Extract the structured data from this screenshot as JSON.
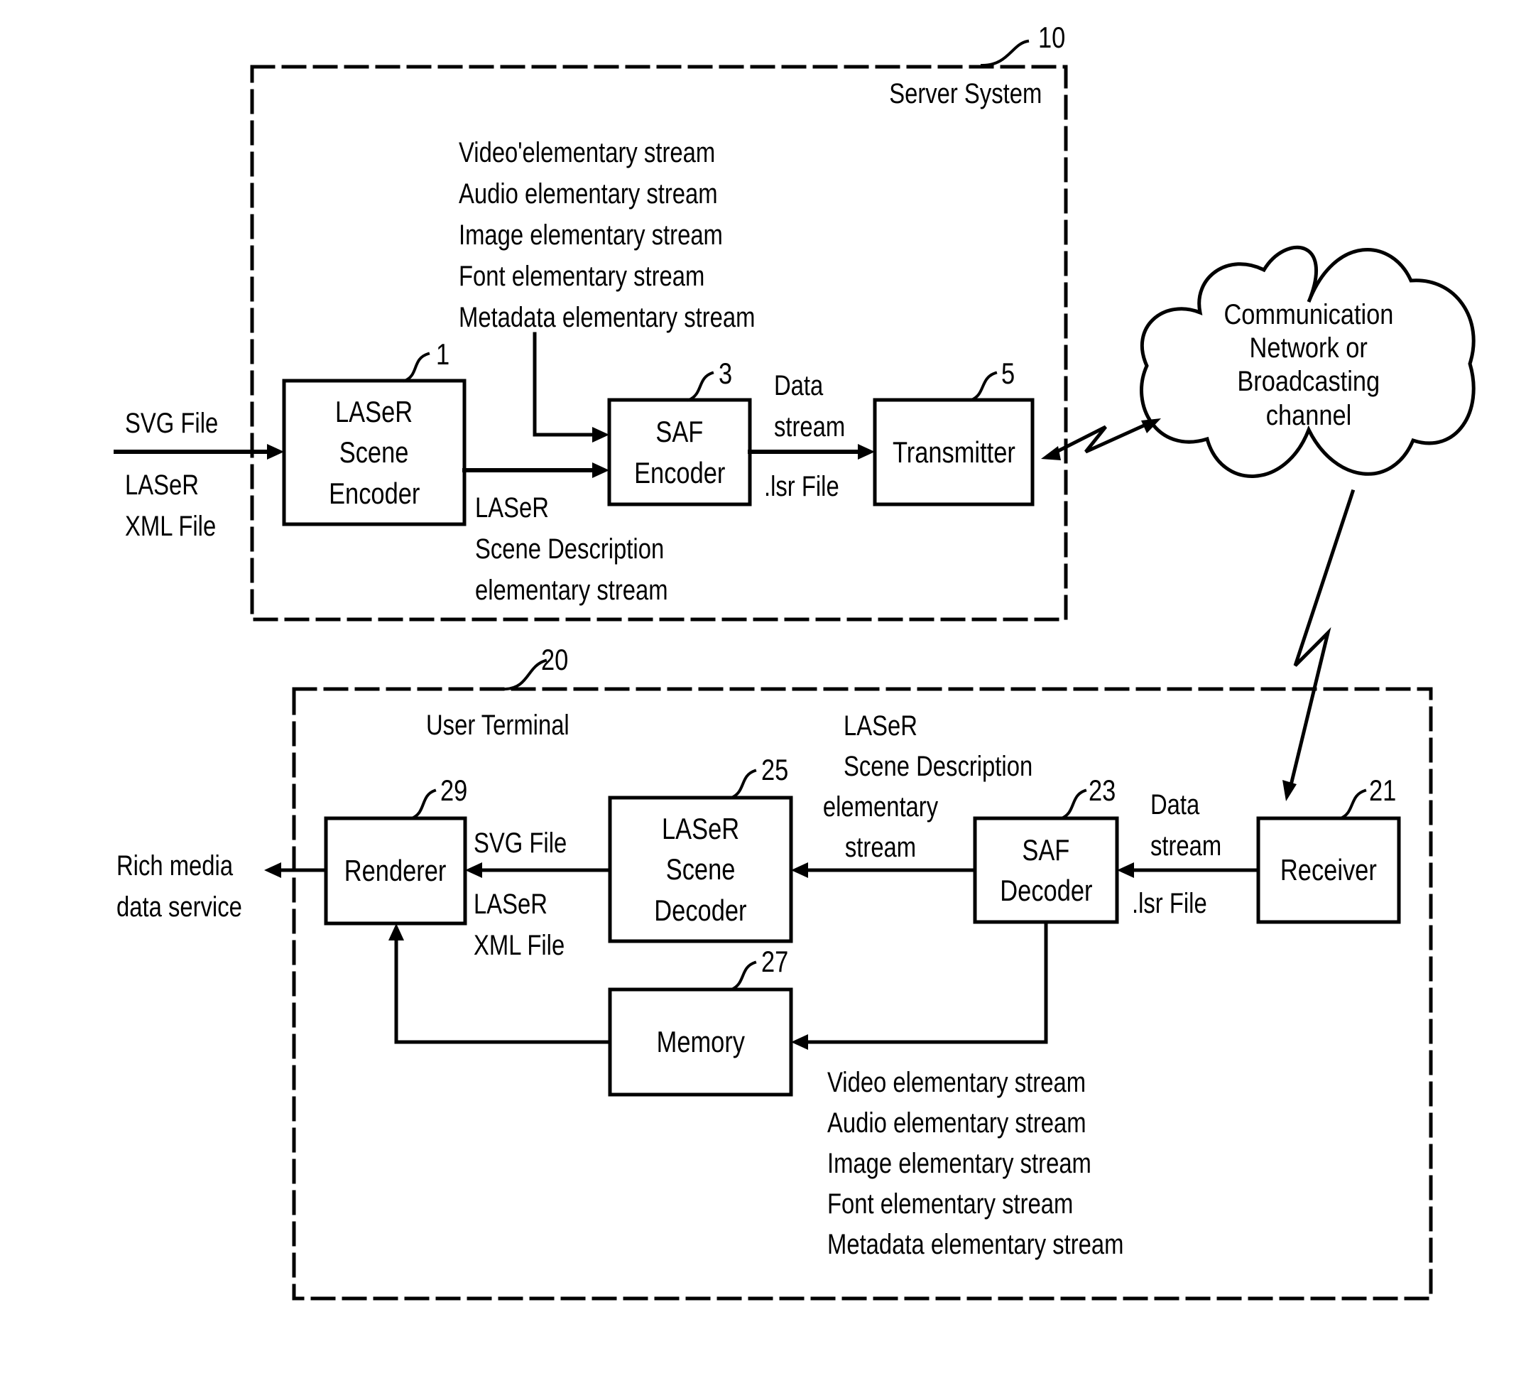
{
  "server_system": {
    "ref": "10",
    "title": "Server System",
    "input_labels": [
      "SVG File",
      "LASeR",
      "XML File"
    ],
    "stream_list": [
      "Video'elementary stream",
      "Audio elementary stream",
      "Image elementary stream",
      "Font elementary stream",
      "Metadata elementary stream"
    ],
    "scene_encoder": {
      "ref": "1",
      "lines": [
        "LASeR",
        "Scene",
        "Encoder"
      ]
    },
    "saf_encoder": {
      "ref": "3",
      "lines": [
        "SAF",
        "Encoder"
      ]
    },
    "transmitter": {
      "ref": "5",
      "lines": [
        "Transmitter"
      ]
    },
    "scene_description_labels": [
      "LASeR",
      "Scene Description",
      "elementary stream"
    ],
    "data_stream_labels": [
      "Data",
      "stream"
    ],
    "lsr_label": ".lsr File"
  },
  "network": {
    "lines": [
      "Communication",
      "Network or",
      "Broadcasting",
      "channel"
    ]
  },
  "user_terminal": {
    "ref": "20",
    "title": "User Terminal",
    "output_labels": [
      "Rich media",
      "data service"
    ],
    "renderer": {
      "ref": "29",
      "lines": [
        "Renderer"
      ]
    },
    "scene_decoder": {
      "ref": "25",
      "lines": [
        "LASeR",
        "Scene",
        "Decoder"
      ]
    },
    "saf_decoder": {
      "ref": "23",
      "lines": [
        "SAF",
        "Decoder"
      ]
    },
    "receiver": {
      "ref": "21",
      "lines": [
        "Receiver"
      ]
    },
    "memory": {
      "ref": "27",
      "lines": [
        "Memory"
      ]
    },
    "renderer_input_labels": [
      "SVG File",
      "LASeR",
      "XML File"
    ],
    "scene_description_labels": [
      "LASeR",
      "Scene Description",
      "elementary",
      "stream"
    ],
    "data_stream_labels": [
      "Data",
      "stream"
    ],
    "lsr_label": ".lsr File",
    "stream_list": [
      "Video elementary stream",
      "Audio elementary stream",
      "Image elementary stream",
      "Font elementary stream",
      "Metadata elementary stream"
    ]
  }
}
